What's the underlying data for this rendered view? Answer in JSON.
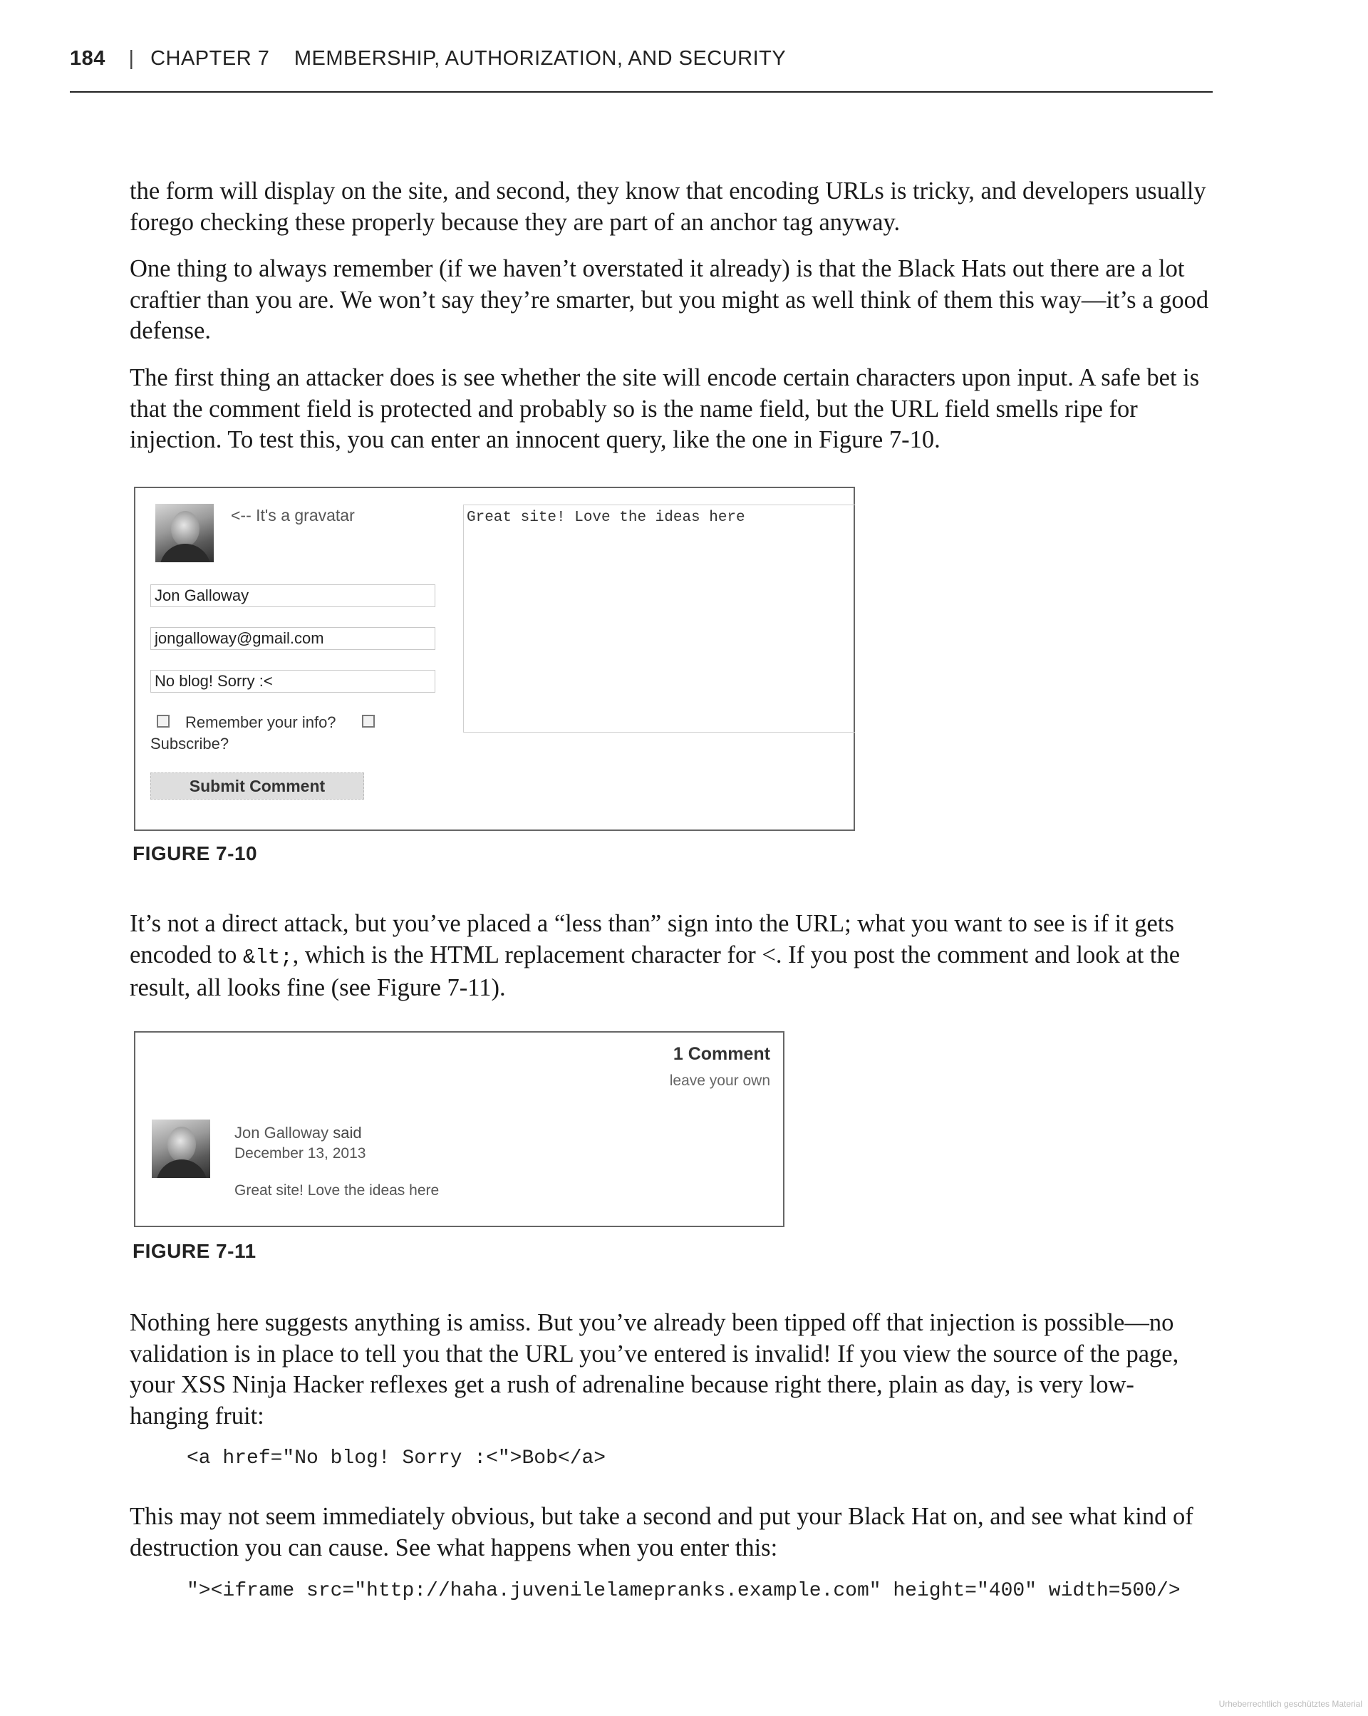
{
  "header": {
    "page_number": "184",
    "separator": "|",
    "chapter": "CHAPTER 7",
    "title": "MEMBERSHIP, AUTHORIZATION, AND SECURITY"
  },
  "paragraphs": {
    "p1": "the form will  display on the site, and second, they know that encoding URLs is tricky, and developers usually forego checking these properly because they are part of an anchor tag anyway.",
    "p2": "One thing to always remember (if we haven’t overstated it already) is that the Black Hats out there are a lot craftier than you are. We won’t say they’re smarter, but you might as well think of them this way—it’s a good defense.",
    "p3": "The first thing an attacker does is see whether the site will encode certain characters upon input. A safe bet is that the comment field is protected and probably so is the name field, but the URL field smells ripe for injection. To test this, you can enter an innocent query, like the one in Figure 7-10.",
    "p4_before_code": "It’s not a direct attack, but you’ve placed a “less than” sign into the URL; what you want to see is if it gets encoded to ",
    "p4_code": "&lt;",
    "p4_after_code": ", which is the HTML replacement character for <. If you post the comment and look at the result, all looks fine (see Figure 7-11).",
    "p5": "Nothing here suggests anything is amiss. But you’ve already been tipped off that injection is possible—no validation is in place to tell you that the URL you’ve entered is invalid! If you view the source of the page, your XSS Ninja Hacker reflexes get a rush of adrenaline because right there, plain as day, is very low-hanging fruit:",
    "p6": "This may not seem immediately obvious, but take a second and put your Black Hat on, and see what kind of destruction you can cause. See what happens when you enter this:"
  },
  "code": {
    "block1": "<a href=\"No blog! Sorry :<\">Bob</a>",
    "block2": "\"><iframe src=\"http://haha.juvenilelamepranks.example.com\" height=\"400\" width=500/>"
  },
  "figure1": {
    "caption": "FIGURE 7-10",
    "gravatar_note": "<-- It's a gravatar",
    "name_value": "Jon Galloway",
    "email_value": "jongalloway@gmail.com",
    "url_value": "No blog! Sorry :<",
    "comment_value": "Great site! Love the ideas here",
    "remember_label": "Remember your info?",
    "subscribe_label": "Subscribe?",
    "submit_label": "Submit Comment"
  },
  "figure2": {
    "caption": "FIGURE 7-11",
    "comment_count": "1 Comment",
    "leave_own": "leave your own",
    "author": "Jon Galloway",
    "said": "said",
    "date": "December 13, 2013",
    "comment_text": "Great site! Love the ideas here"
  },
  "watermark": "Urheberrechtlich geschütztes Material"
}
